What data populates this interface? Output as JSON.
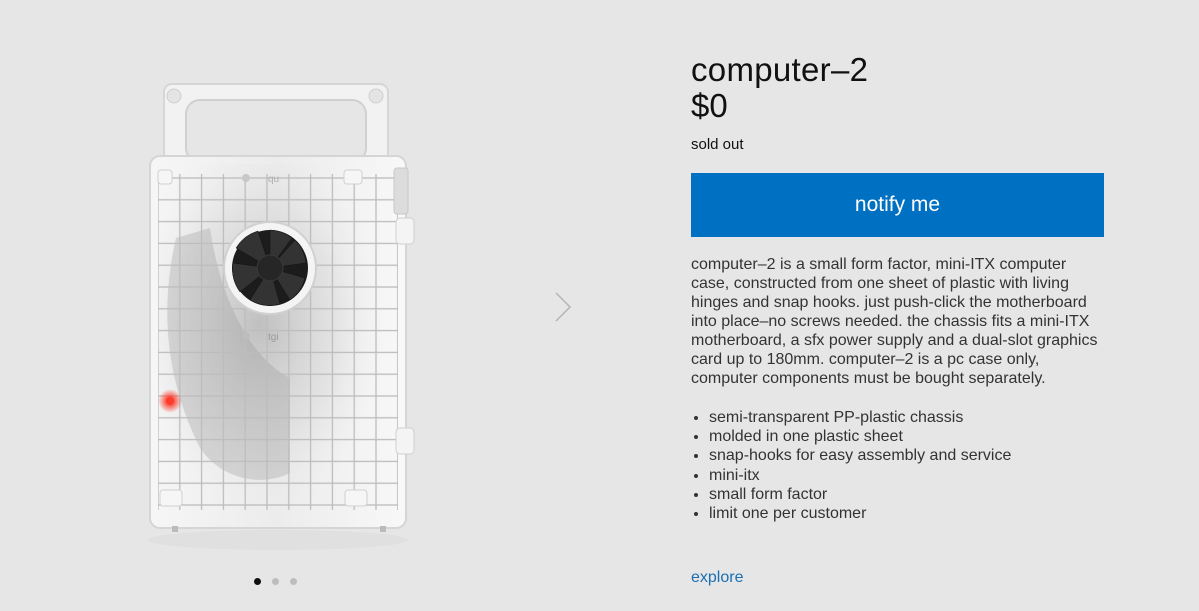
{
  "product": {
    "title": "computer–2",
    "price": "$0",
    "stock_status": "sold out",
    "notify_label": "notify me",
    "description": "computer–2 is a small form factor, mini-ITX computer case, constructed from one sheet of plastic with living hinges and snap hooks. just push-click the motherboard into place–no screws needed. the chassis fits a mini-ITX motherboard, a sfx power supply and a dual-slot graphics card up to 180mm. computer–2 is a pc case only, computer components must be bought separately.",
    "features": [
      "semi-transparent PP-plastic chassis",
      "molded in one plastic sheet",
      "snap-hooks for easy assembly and service",
      "mini-itx",
      "small form factor",
      "limit one per customer"
    ],
    "explore_label": "explore"
  },
  "gallery": {
    "slide_count": 3,
    "active_slide": 1,
    "next_icon": "chevron-right-icon",
    "case_panel_labels": [
      "qu",
      "tgi"
    ]
  },
  "colors": {
    "background": "#e6e6e6",
    "accent": "#0071c2",
    "link": "#1a6fb3",
    "led": "#ff2a1a"
  }
}
